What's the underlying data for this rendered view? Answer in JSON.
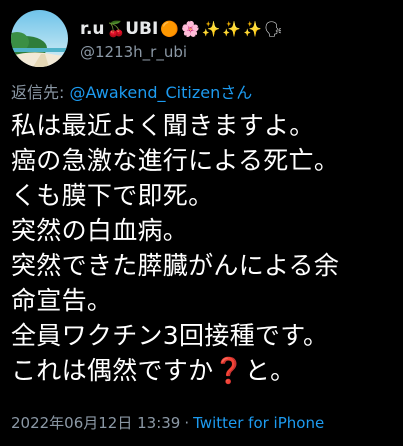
{
  "user": {
    "display_name": "r.u",
    "name_suffix": "UBI",
    "handle": "@1213h_r_ubi",
    "emojis": {
      "cherry": "🍒",
      "orange_circle": "🟠",
      "cherry_blossom": "🌸",
      "sparkles": "✨",
      "speaking_head": "🗣"
    }
  },
  "reply": {
    "prefix": "返信先: ",
    "target": "@Awakend_Citizenさん"
  },
  "tweet": {
    "lines": [
      "私は最近よく聞きますよ。",
      "癌の急激な進行による死亡。",
      "くも膜下で即死。",
      "突然の白血病。",
      "突然できた膵臓がんによる余",
      "命宣告。",
      "全員ワクチン3回接種です。",
      "これは偶然ですか"
    ],
    "question_mark": "❓",
    "last_line_suffix": "と。"
  },
  "meta": {
    "timestamp": "2022年06月12日 13:39",
    "separator": "·",
    "source": "Twitter for iPhone"
  },
  "colors": {
    "background": "#000000",
    "text": "#ffffff",
    "muted": "#8b98a5",
    "link": "#1d9bf0",
    "accent_red": "#e0245e"
  }
}
